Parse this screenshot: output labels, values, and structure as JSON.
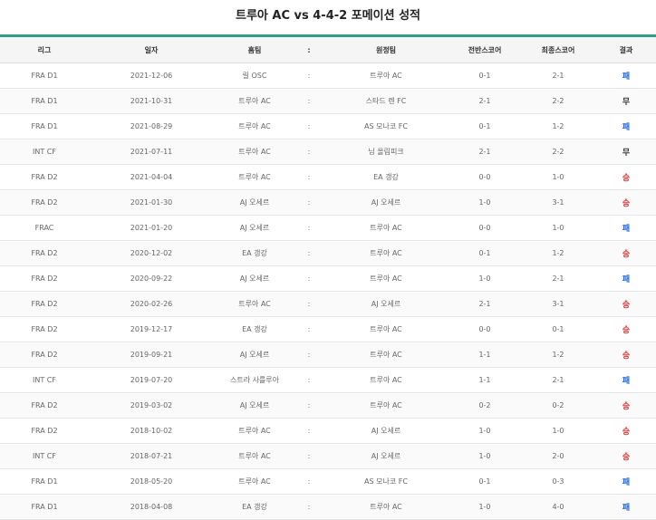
{
  "title": "트루아 AC vs 4-4-2 포메이션 성적",
  "headers": [
    "리그",
    "일자",
    "홈팀",
    ":",
    "원정팀",
    "전반스코어",
    "최종스코어",
    "결과"
  ],
  "colors": {
    "win": "#e03131",
    "lose": "#1c64d8",
    "draw": "#333333",
    "accent": "#2f9e8a"
  },
  "rows": [
    {
      "league": "FRA D1",
      "date": "2021-12-06",
      "home": "릴 OSC",
      "sep": ":",
      "away": "트루아 AC",
      "half": "0-1",
      "final": "2-1",
      "result": "패",
      "kind": "lose"
    },
    {
      "league": "FRA D1",
      "date": "2021-10-31",
      "home": "트루아 AC",
      "sep": ":",
      "away": "스타드 렌 FC",
      "half": "2-1",
      "final": "2-2",
      "result": "무",
      "kind": "draw"
    },
    {
      "league": "FRA D1",
      "date": "2021-08-29",
      "home": "트루아 AC",
      "sep": ":",
      "away": "AS 모나코 FC",
      "half": "0-1",
      "final": "1-2",
      "result": "패",
      "kind": "lose"
    },
    {
      "league": "INT CF",
      "date": "2021-07-11",
      "home": "트루아 AC",
      "sep": ":",
      "away": "님 올림피크",
      "half": "2-1",
      "final": "2-2",
      "result": "무",
      "kind": "draw"
    },
    {
      "league": "FRA D2",
      "date": "2021-04-04",
      "home": "트루아 AC",
      "sep": ":",
      "away": "EA 갱강",
      "half": "0-0",
      "final": "1-0",
      "result": "승",
      "kind": "win"
    },
    {
      "league": "FRA D2",
      "date": "2021-01-30",
      "home": "AJ 오세르",
      "sep": ":",
      "away": "AJ 오세르",
      "half": "1-0",
      "final": "3-1",
      "result": "승",
      "kind": "win"
    },
    {
      "league": "FRAC",
      "date": "2021-01-20",
      "home": "AJ 오세르",
      "sep": ":",
      "away": "트루아 AC",
      "half": "0-0",
      "final": "1-0",
      "result": "패",
      "kind": "lose"
    },
    {
      "league": "FRA D2",
      "date": "2020-12-02",
      "home": "EA 갱강",
      "sep": ":",
      "away": "트루아 AC",
      "half": "0-1",
      "final": "1-2",
      "result": "승",
      "kind": "win"
    },
    {
      "league": "FRA D2",
      "date": "2020-09-22",
      "home": "AJ 오세르",
      "sep": ":",
      "away": "트루아 AC",
      "half": "1-0",
      "final": "2-1",
      "result": "패",
      "kind": "lose"
    },
    {
      "league": "FRA D2",
      "date": "2020-02-26",
      "home": "트루아 AC",
      "sep": ":",
      "away": "AJ 오세르",
      "half": "2-1",
      "final": "3-1",
      "result": "승",
      "kind": "win"
    },
    {
      "league": "FRA D2",
      "date": "2019-12-17",
      "home": "EA 갱강",
      "sep": ":",
      "away": "트루아 AC",
      "half": "0-0",
      "final": "0-1",
      "result": "승",
      "kind": "win"
    },
    {
      "league": "FRA D2",
      "date": "2019-09-21",
      "home": "AJ 오세르",
      "sep": ":",
      "away": "트루아 AC",
      "half": "1-1",
      "final": "1-2",
      "result": "승",
      "kind": "win"
    },
    {
      "league": "INT CF",
      "date": "2019-07-20",
      "home": "스트라 사를루아",
      "sep": ":",
      "away": "트루아 AC",
      "half": "1-1",
      "final": "2-1",
      "result": "패",
      "kind": "lose"
    },
    {
      "league": "FRA D2",
      "date": "2019-03-02",
      "home": "AJ 오세르",
      "sep": ":",
      "away": "트루아 AC",
      "half": "0-2",
      "final": "0-2",
      "result": "승",
      "kind": "win"
    },
    {
      "league": "FRA D2",
      "date": "2018-10-02",
      "home": "트루아 AC",
      "sep": ":",
      "away": "AJ 오세르",
      "half": "1-0",
      "final": "1-0",
      "result": "승",
      "kind": "win"
    },
    {
      "league": "INT CF",
      "date": "2018-07-21",
      "home": "트루아 AC",
      "sep": ":",
      "away": "AJ 오세르",
      "half": "1-0",
      "final": "2-0",
      "result": "승",
      "kind": "win"
    },
    {
      "league": "FRA D1",
      "date": "2018-05-20",
      "home": "트루아 AC",
      "sep": ":",
      "away": "AS 모나코 FC",
      "half": "0-1",
      "final": "0-3",
      "result": "패",
      "kind": "lose"
    },
    {
      "league": "FRA D1",
      "date": "2018-04-08",
      "home": "EA 갱강",
      "sep": ":",
      "away": "트루아 AC",
      "half": "1-0",
      "final": "4-0",
      "result": "패",
      "kind": "lose"
    }
  ]
}
